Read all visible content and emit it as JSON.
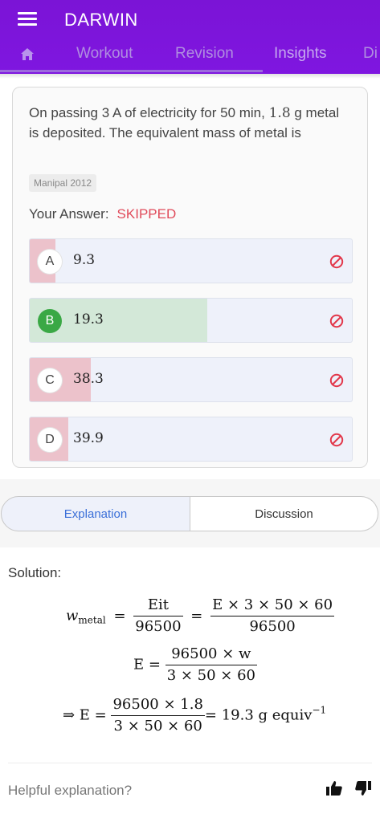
{
  "app": {
    "title": "DARWIN"
  },
  "tabs": [
    {
      "label": "Workout"
    },
    {
      "label": "Revision"
    },
    {
      "label": "Insights"
    },
    {
      "label": "Di"
    }
  ],
  "question": {
    "text_before": "On passing 3 A of electricity for 50 min, ",
    "math": "1.8",
    "text_after": " g metal is deposited. The equivalent mass of metal is",
    "source": "Manipal 2012",
    "answer_label": "Your Answer:",
    "answer_value": "SKIPPED"
  },
  "options": [
    {
      "letter": "A",
      "value": "9.3",
      "percent": 8,
      "correct": false
    },
    {
      "letter": "B",
      "value": "19.3",
      "percent": 55,
      "correct": true
    },
    {
      "letter": "C",
      "value": "38.3",
      "percent": 19,
      "correct": false
    },
    {
      "letter": "D",
      "value": "39.9",
      "percent": 12,
      "correct": false
    }
  ],
  "colors": {
    "appbar": "#7b14d6",
    "correct_fill": "#d3e8d8",
    "wrong_fill": "#ecc2cb",
    "skipped": "#e04a5a",
    "correct_badge": "#3aa845",
    "status_icon": "#e2374a"
  },
  "solution_tabs": {
    "explanation": "Explanation",
    "discussion": "Discussion"
  },
  "solution": {
    "label": "Solution:",
    "eq1": {
      "lhs": "w",
      "lhs_sub": "metal",
      "f1_num": "Eit",
      "f1_den": "96500",
      "f2_num": "E × 3 × 50 × 60",
      "f2_den": "96500"
    },
    "eq2": {
      "lhs": "E =",
      "num": "96500 × w",
      "den": "3 × 50 × 60"
    },
    "eq3": {
      "lhs": "⇒ E =",
      "num": "96500 × 1.8",
      "den": "3 × 50 × 60",
      "rhs": "= 19.3 g equiv",
      "sup": "−1"
    }
  },
  "feedback": {
    "label": "Helpful explanation?",
    "up_icon": "thumbs-up-icon",
    "down_icon": "thumbs-down-icon"
  }
}
